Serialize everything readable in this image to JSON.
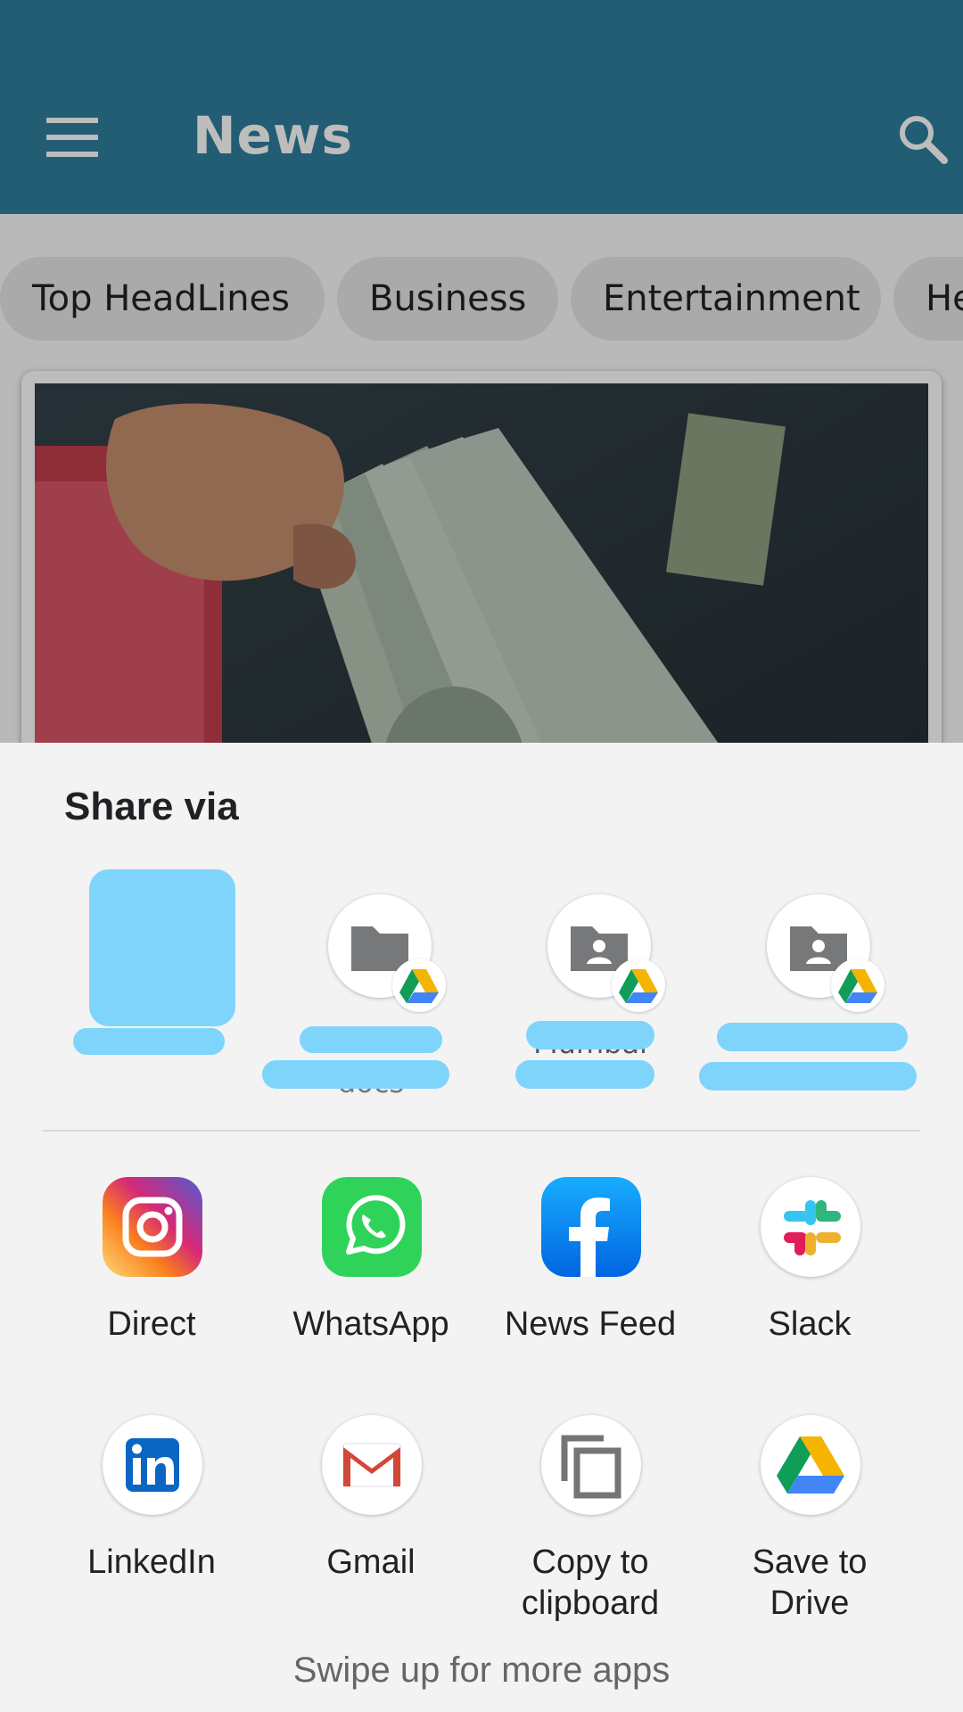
{
  "app": {
    "title": "News",
    "menu_icon": "hamburger-menu-icon",
    "search_icon": "search-icon",
    "toolbar_color": "#2e7e9b",
    "categories": [
      "Top HeadLines",
      "Business",
      "Entertainment",
      "He"
    ]
  },
  "share_sheet": {
    "title": "Share via",
    "direct_targets": [
      {
        "icon": "drive-folder-icon",
        "label1": "",
        "label2": ""
      },
      {
        "icon": "drive-folder-icon",
        "label1": "",
        "label2": "docs"
      },
      {
        "icon": "drive-shared-folder-icon",
        "label1": "Mumbai",
        "label2": ""
      },
      {
        "icon": "drive-shared-folder-icon",
        "label1": "",
        "label2": ""
      }
    ],
    "apps": [
      {
        "label": "Direct",
        "icon": "instagram-icon"
      },
      {
        "label": "WhatsApp",
        "icon": "whatsapp-icon"
      },
      {
        "label": "News Feed",
        "icon": "facebook-icon"
      },
      {
        "label": "Slack",
        "icon": "slack-icon"
      },
      {
        "label": "LinkedIn",
        "icon": "linkedin-icon"
      },
      {
        "label": "Gmail",
        "icon": "gmail-icon"
      },
      {
        "label": "Copy to clipboard",
        "icon": "copy-icon"
      },
      {
        "label": "Save to Drive",
        "icon": "google-drive-icon"
      }
    ],
    "hint": "Swipe up for more apps"
  }
}
